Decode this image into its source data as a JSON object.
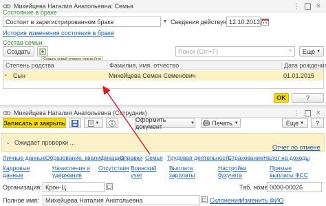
{
  "top_window": {
    "title": "Михейцева Наталия Анатольевна: Семья",
    "marital_section_label": "Состояние в браке",
    "marital_status_value": "Состоит в зарегистрированном браке",
    "effective_label": "Сведения действуют с:",
    "effective_date": "12.10.2013",
    "history_link": "История изменения состояния в браке",
    "family_section_label": "Состав семьи",
    "create_button": "Создать",
    "search_placeholder": "Поиск (Ctrl+F)",
    "more_button": "Еще",
    "tooltip": "Создать новый элемент списка (Ins)",
    "table": {
      "columns": [
        "Степень родства",
        "Фамилия, имя, отчество",
        "Дата рождения"
      ],
      "rows": [
        {
          "relation": "Сын",
          "name": "Михейцева Семен Семенович",
          "birth": "01.01.2015"
        }
      ]
    },
    "ok_button": "OK"
  },
  "bottom_window": {
    "title": "Михейцева Наталия Анатольевна (Сотрудник)",
    "save_close_button": "Записать и закрыть",
    "print_doc_button": "Оформить документ",
    "print_button": "Печать",
    "more_button": "Еще",
    "help_button": "?",
    "status_text": "Ожидает проверки ...",
    "rejection_link": "Отчет по отмене",
    "tabs_row1": [
      "Личные данные",
      "Образование, квалификация",
      "Справки",
      "Семья",
      "Трудовая деятельность",
      "Страхование",
      "Налог на доходы"
    ],
    "tabs_row2": [
      [
        "Кадровые",
        "данные"
      ],
      [
        "Начисления и",
        "удержания"
      ],
      [
        "Отсутствия"
      ],
      [
        "Воинский",
        "учет"
      ],
      [
        "Выплата",
        "зарплаты"
      ],
      [
        "Настройки",
        "бухучета"
      ],
      [
        "Прямые",
        "выплаты ФСС"
      ]
    ],
    "organization_label": "Организация:",
    "organization_value": "Крон-Ц",
    "tab_number_label": "Таб. номер:",
    "tab_number_value": "0000-00026",
    "full_name_label": "Полное имя:",
    "full_name_value": "Михейцева Наталия Анатольевна",
    "declension_link": "Склонения",
    "change_name_link": "Изменить ФИО"
  },
  "colors": {
    "accent_green": "#2e8b2e",
    "link_blue": "#1a5cb0",
    "yellow_button": "#f5d90a",
    "row_highlight": "#fbf1c2",
    "status_bar": "#fbf1c8",
    "arrow": "#d62020"
  },
  "icons": {
    "window_menu": "chain-link-icon",
    "window_controls": [
      "menu-dots-icon",
      "maximize-icon",
      "close-icon"
    ],
    "add": "add-item-icon",
    "save": "floppy-disk-icon",
    "info": "info-icon",
    "dropdown": "dropdown-icon",
    "calendar": "calendar-icon"
  }
}
